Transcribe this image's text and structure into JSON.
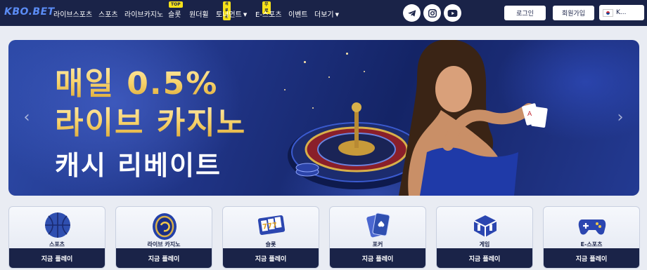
{
  "brand": {
    "logo": "KBO.BET"
  },
  "nav": {
    "items": [
      {
        "label": "라이브스포츠",
        "badge": "",
        "caret": ""
      },
      {
        "label": "스포츠",
        "badge": "",
        "caret": ""
      },
      {
        "label": "라이브카지노",
        "badge": "",
        "caret": ""
      },
      {
        "label": "슬롯",
        "badge": "TOP",
        "caret": ""
      },
      {
        "label": "원더휠",
        "badge": "",
        "caret": ""
      },
      {
        "label": "토너먼트",
        "badge": "새로운",
        "caret": "▼"
      },
      {
        "label": "E-스포츠",
        "badge": "무료",
        "caret": ""
      },
      {
        "label": "이벤트",
        "badge": "",
        "caret": ""
      },
      {
        "label": "더보기",
        "badge": "",
        "caret": "▼"
      }
    ]
  },
  "social": [
    {
      "icon": "telegram-icon"
    },
    {
      "icon": "instagram-icon"
    },
    {
      "icon": "youtube-icon"
    }
  ],
  "auth": {
    "login": "로그인",
    "signup": "회원가입"
  },
  "language": {
    "selected": "K..."
  },
  "banner": {
    "line1": "매일 0.5%",
    "line2": "라이브 카지노",
    "line3": "캐시 리베이트",
    "prev_icon": "chevron-left-icon",
    "next_icon": "chevron-right-icon"
  },
  "categories": [
    {
      "label": "스포츠",
      "play": "지금 플레이",
      "icon": "basketball-icon"
    },
    {
      "label": "라이브 카지노",
      "play": "지금 플레이",
      "icon": "casino-chip-icon"
    },
    {
      "label": "슬롯",
      "play": "지금 플레이",
      "icon": "slot-machine-icon"
    },
    {
      "label": "포커",
      "play": "지금 플레이",
      "icon": "playing-cards-icon"
    },
    {
      "label": "게임",
      "play": "지금 플레이",
      "icon": "game-dice-icon"
    },
    {
      "label": "E-스포츠",
      "play": "지금 플레이",
      "icon": "gamepad-icon"
    }
  ],
  "colors": {
    "nav_bg": "#1a2348",
    "accent": "#5b8cf5",
    "badge": "#f7e21a",
    "gold": "#f6d67b"
  }
}
